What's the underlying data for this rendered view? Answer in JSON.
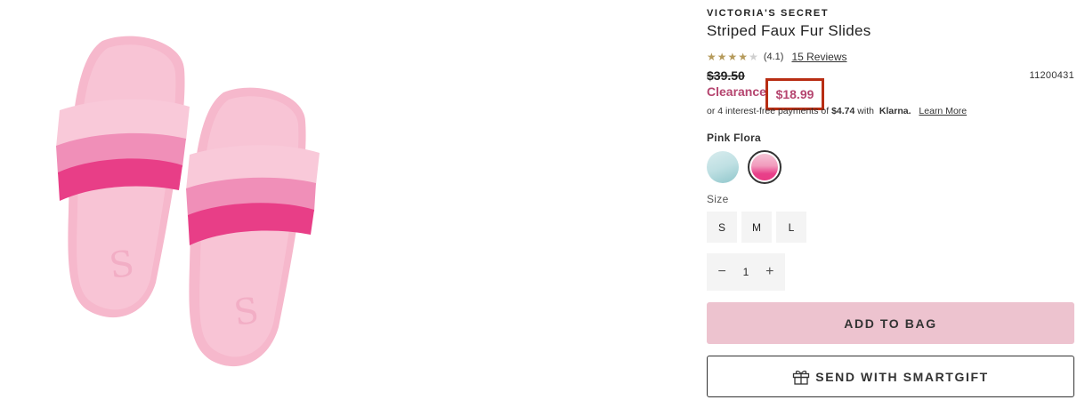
{
  "product": {
    "brand": "VICTORIA'S SECRET",
    "title": "Striped Faux Fur Slides",
    "rating": {
      "value": 4.1,
      "stars_filled": 4,
      "stars_total": 5,
      "value_label": "(4.1)",
      "reviews_label": "15 Reviews"
    },
    "original_price": "$39.50",
    "sku": "11200431",
    "clearance_label": "Clearance",
    "sale_price": "$18.99",
    "klarna": {
      "prefix": "or 4 interest-free payments of",
      "amount": "$4.74",
      "with": "with",
      "brand": "Klarna.",
      "learn_more": "Learn More"
    },
    "image_icon": "pink-fur-slides-product-image"
  },
  "color": {
    "selected_label": "Pink Flora",
    "swatches": [
      {
        "name": "blue",
        "selected": false
      },
      {
        "name": "pink",
        "selected": true
      }
    ]
  },
  "size": {
    "label": "Size",
    "options": [
      "S",
      "M",
      "L"
    ]
  },
  "quantity": {
    "minus_icon": "minus-icon",
    "value": "1",
    "plus_icon": "plus-icon"
  },
  "actions": {
    "add_to_bag": "ADD TO BAG",
    "send_gift": "SEND WITH SMARTGIFT",
    "gift_icon": "gift-icon"
  },
  "colors": {
    "accent_pink": "#edc3cf",
    "clearance": "#b5456f",
    "highlight_box": "#b82d13",
    "star": "#b59a5b"
  }
}
